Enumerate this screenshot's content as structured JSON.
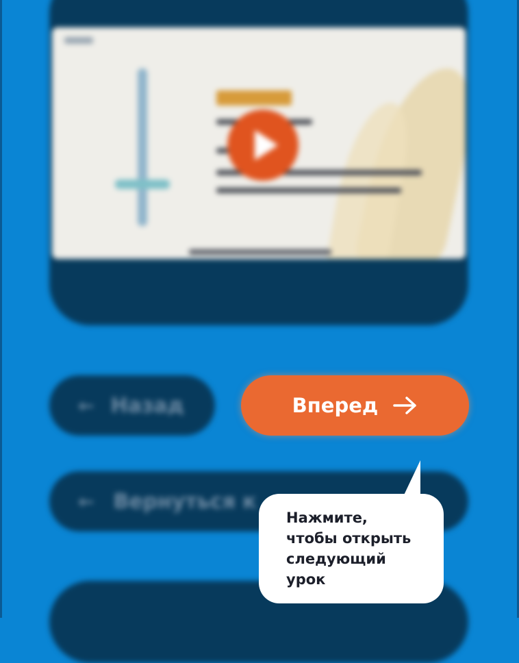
{
  "video": {
    "play_icon": "play-icon",
    "accent_color": "#e0541f"
  },
  "navigation": {
    "back_label": "Назад",
    "return_label": "Вернуться к ...",
    "forward_label": "Вперед",
    "forward_icon": "arrow-right-icon",
    "back_icon": "arrow-left-icon",
    "forward_color": "#ea6931"
  },
  "tooltip": {
    "lines": [
      "Нажмите,",
      "чтобы открыть",
      "следующий",
      "урок"
    ]
  },
  "colors": {
    "background": "#0a85d4",
    "card": "#073a5c"
  }
}
